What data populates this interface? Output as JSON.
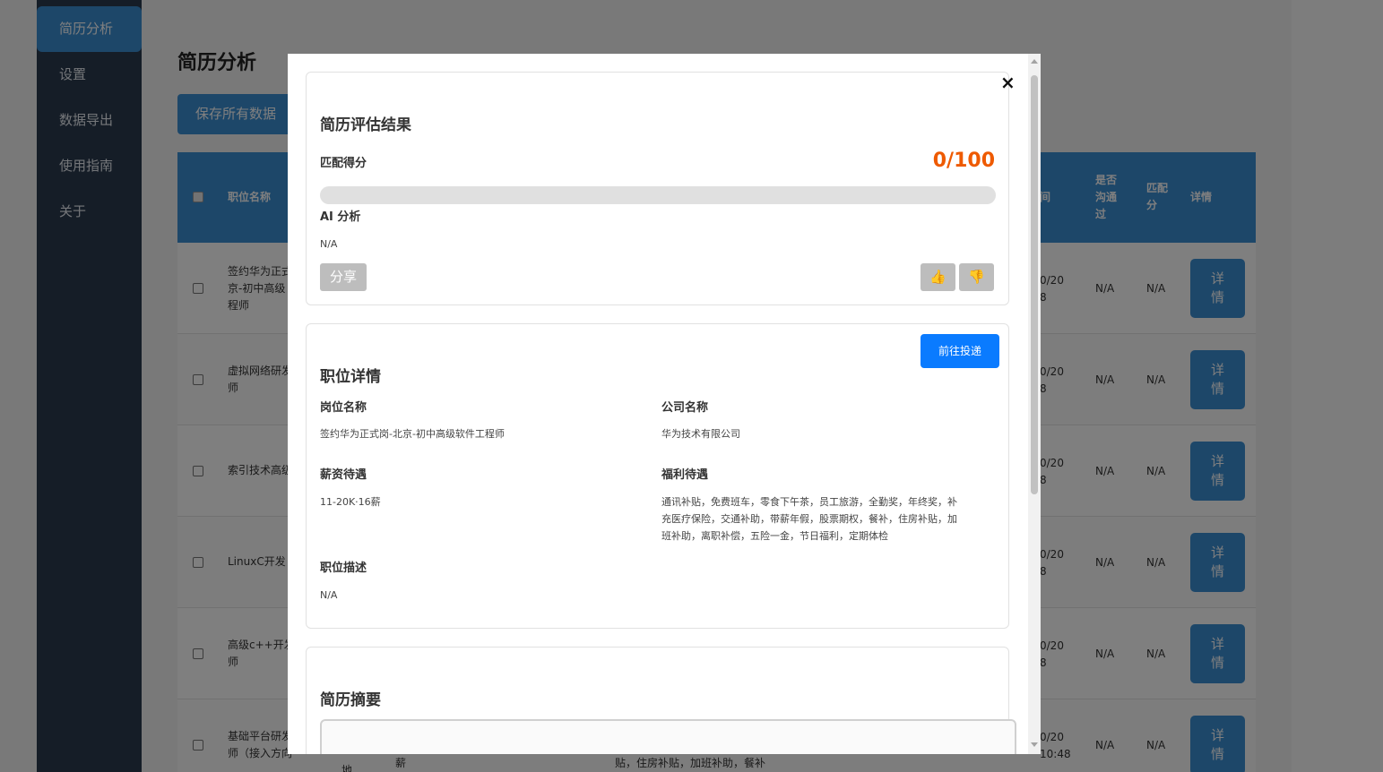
{
  "sidebar": {
    "items": [
      {
        "label": "简历分析",
        "active": true
      },
      {
        "label": "设置"
      },
      {
        "label": "数据导出"
      },
      {
        "label": "使用指南"
      },
      {
        "label": "关于"
      }
    ]
  },
  "main": {
    "title": "简历分析",
    "save_label": "保存所有数据"
  },
  "table": {
    "headers": {
      "position": "职位名称",
      "time_fragment": "间",
      "communicated": [
        "是否",
        "沟通",
        "过"
      ],
      "match": [
        "匹配",
        "分"
      ],
      "detail": "详情"
    },
    "rows": [
      {
        "position": [
          "签约华为正式",
          "京-初中高级",
          "程师"
        ],
        "time": [
          "0/20",
          "8"
        ],
        "communicated": "N/A",
        "match": "N/A",
        "detail": [
          "详",
          "情"
        ]
      },
      {
        "position": [
          "虚拟网络研发",
          "师"
        ],
        "time": [
          "0/20",
          "8"
        ],
        "communicated": "N/A",
        "match": "N/A",
        "detail": [
          "详",
          "情"
        ]
      },
      {
        "position": [
          "索引技术高级"
        ],
        "time": [
          "0/20",
          "8"
        ],
        "communicated": "N/A",
        "match": "N/A",
        "detail": [
          "详",
          "情"
        ]
      },
      {
        "position": [
          "LinuxC开发"
        ],
        "time": [
          "0/20",
          "8"
        ],
        "communicated": "N/A",
        "match": "N/A",
        "detail": [
          "详",
          "情"
        ]
      },
      {
        "position": [
          "高级c++开发",
          "师"
        ],
        "time": [
          "0/20",
          "8"
        ],
        "communicated": "N/A",
        "match": "N/A",
        "detail": [
          "详",
          "情"
        ]
      },
      {
        "position": [
          "基础平台研发",
          "师（接入方向"
        ],
        "time": [
          "0/20",
          "10:48"
        ],
        "communicated": "N/A",
        "match": "N/A",
        "detail": [
          "详",
          "情"
        ],
        "extra": [
          "地",
          "薪",
          "贴，住房补贴，加班补助，餐补"
        ]
      }
    ]
  },
  "modal": {
    "close_glyph": "×",
    "evaluation": {
      "title": "简历评估结果",
      "score_label": "匹配得分",
      "score_text": "0/100",
      "score_value": 0,
      "ai_label": "AI 分析",
      "ai_text": "N/A",
      "share_label": "分享",
      "thumb_up_icon": "👍",
      "thumb_down_icon": "👎"
    },
    "job": {
      "title": "职位详情",
      "apply_label": "前往投递",
      "position_label": "岗位名称",
      "position_value": "签约华为正式岗-北京-初中高级软件工程师",
      "company_label": "公司名称",
      "company_value": "华为技术有限公司",
      "salary_label": "薪资待遇",
      "salary_value": "11-20K·16薪",
      "benefits_label": "福利待遇",
      "benefits_lines": [
        "通讯补贴，免费班车，零食下午茶，员工旅游，全勤奖，年终奖，补",
        "充医疗保险，交通补助，带薪年假，股票期权，餐补，住房补贴，加",
        "班补助，离职补偿，五险一金，节日福利，定期体检"
      ],
      "desc_label": "职位描述",
      "desc_value": "N/A"
    },
    "summary": {
      "title": "简历摘要"
    }
  },
  "colors": {
    "sidebar": "#2b3a4f",
    "accent": "#3b8ed3",
    "score": "#ee5a00",
    "apply": "#0a7bff"
  }
}
